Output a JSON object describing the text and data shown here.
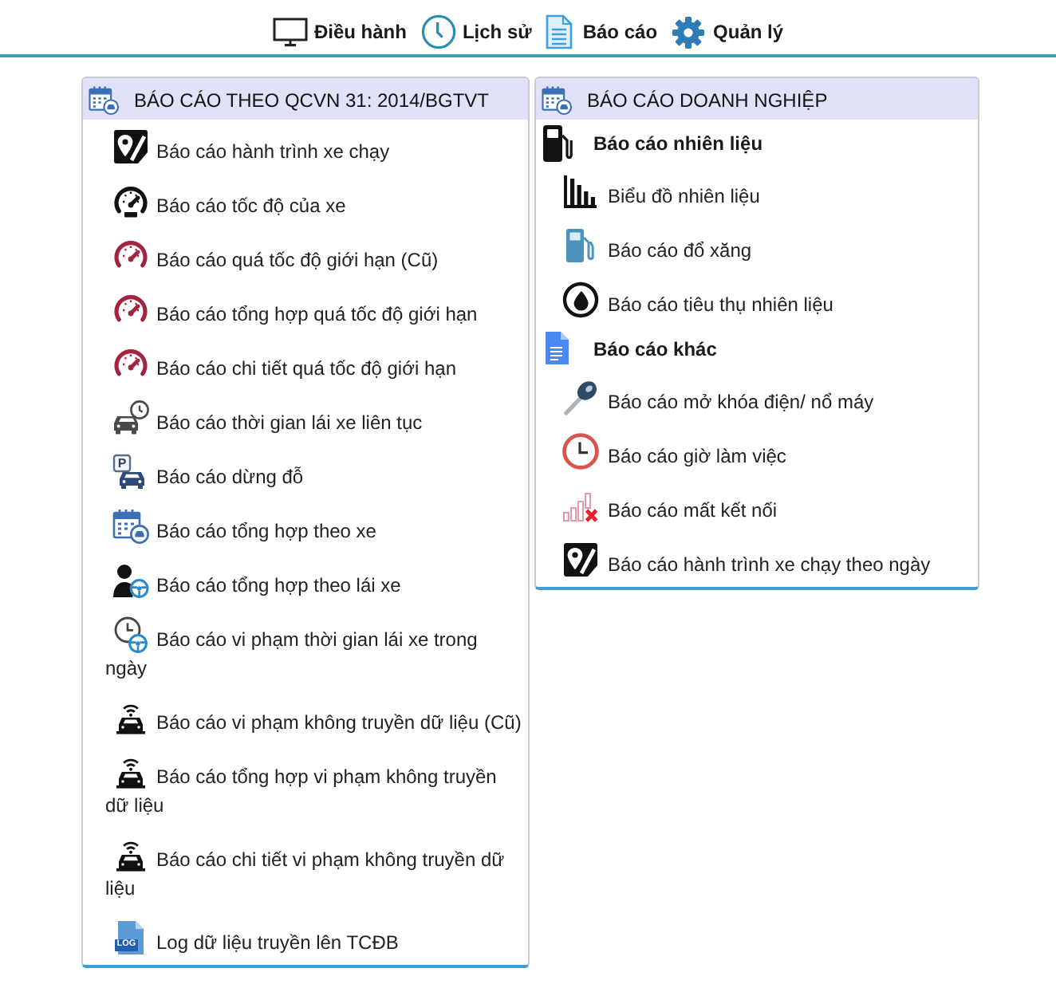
{
  "nav": [
    {
      "label": "Điều hành"
    },
    {
      "label": "Lịch sử"
    },
    {
      "label": "Báo cáo"
    },
    {
      "label": "Quản lý"
    }
  ],
  "qcvn_panel": {
    "title": "BÁO CÁO THEO QCVN 31: 2014/BGTVT",
    "items": [
      {
        "label": "Báo cáo hành trình xe chạy"
      },
      {
        "label": "Báo cáo tốc độ của xe"
      },
      {
        "label": "Báo cáo quá tốc độ giới hạn (Cũ)"
      },
      {
        "label": "Báo cáo tổng hợp quá tốc độ giới hạn"
      },
      {
        "label": "Báo cáo chi tiết quá tốc độ giới hạn"
      },
      {
        "label": "Báo cáo thời gian lái xe liên tục"
      },
      {
        "label": "Báo cáo dừng đỗ",
        "icon_text": "P"
      },
      {
        "label": "Báo cáo tổng hợp theo xe"
      },
      {
        "label": "Báo cáo tổng hợp theo lái xe"
      },
      {
        "label": "Báo cáo vi phạm thời gian lái xe trong ngày"
      },
      {
        "label": "Báo cáo vi phạm không truyền dữ liệu (Cũ)"
      },
      {
        "label": "Báo cáo tổng hợp vi phạm không truyền dữ liệu"
      },
      {
        "label": "Báo cáo chi tiết vi phạm không truyền dữ liệu"
      },
      {
        "label": "Log dữ liệu truyền lên TCĐB",
        "icon_text": "LOG"
      }
    ]
  },
  "business_panel": {
    "title": "BÁO CÁO DOANH NGHIỆP",
    "groups": [
      {
        "heading": "Báo cáo nhiên liệu",
        "items": [
          {
            "label": "Biểu đồ nhiên liệu"
          },
          {
            "label": "Báo cáo đổ xăng"
          },
          {
            "label": "Báo cáo tiêu thụ nhiên liệu"
          }
        ]
      },
      {
        "heading": "Báo cáo khác",
        "items": [
          {
            "label": "Báo cáo mở khóa điện/ nổ máy"
          },
          {
            "label": "Báo cáo giờ làm việc"
          },
          {
            "label": "Báo cáo mất kết nối"
          },
          {
            "label": "Báo cáo hành trình xe chạy theo ngày"
          }
        ]
      }
    ]
  }
}
